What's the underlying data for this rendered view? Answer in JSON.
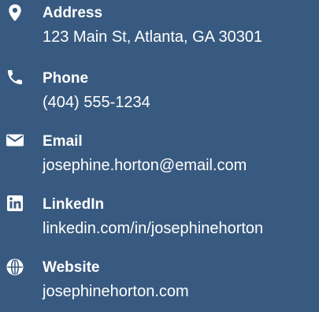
{
  "contact": {
    "items": [
      {
        "icon": "map-pin-icon",
        "label": "Address",
        "value": "123 Main St, Atlanta, GA 30301"
      },
      {
        "icon": "phone-icon",
        "label": "Phone",
        "value": "(404) 555-1234"
      },
      {
        "icon": "envelope-icon",
        "label": "Email",
        "value": "josephine.horton@email.com"
      },
      {
        "icon": "linkedin-icon",
        "label": "LinkedIn",
        "value": "linkedin.com/in/josephinehorton"
      },
      {
        "icon": "globe-icon",
        "label": "Website",
        "value": "josephinehorton.com"
      }
    ]
  },
  "colors": {
    "background": "#385a80",
    "text": "#ffffff"
  }
}
